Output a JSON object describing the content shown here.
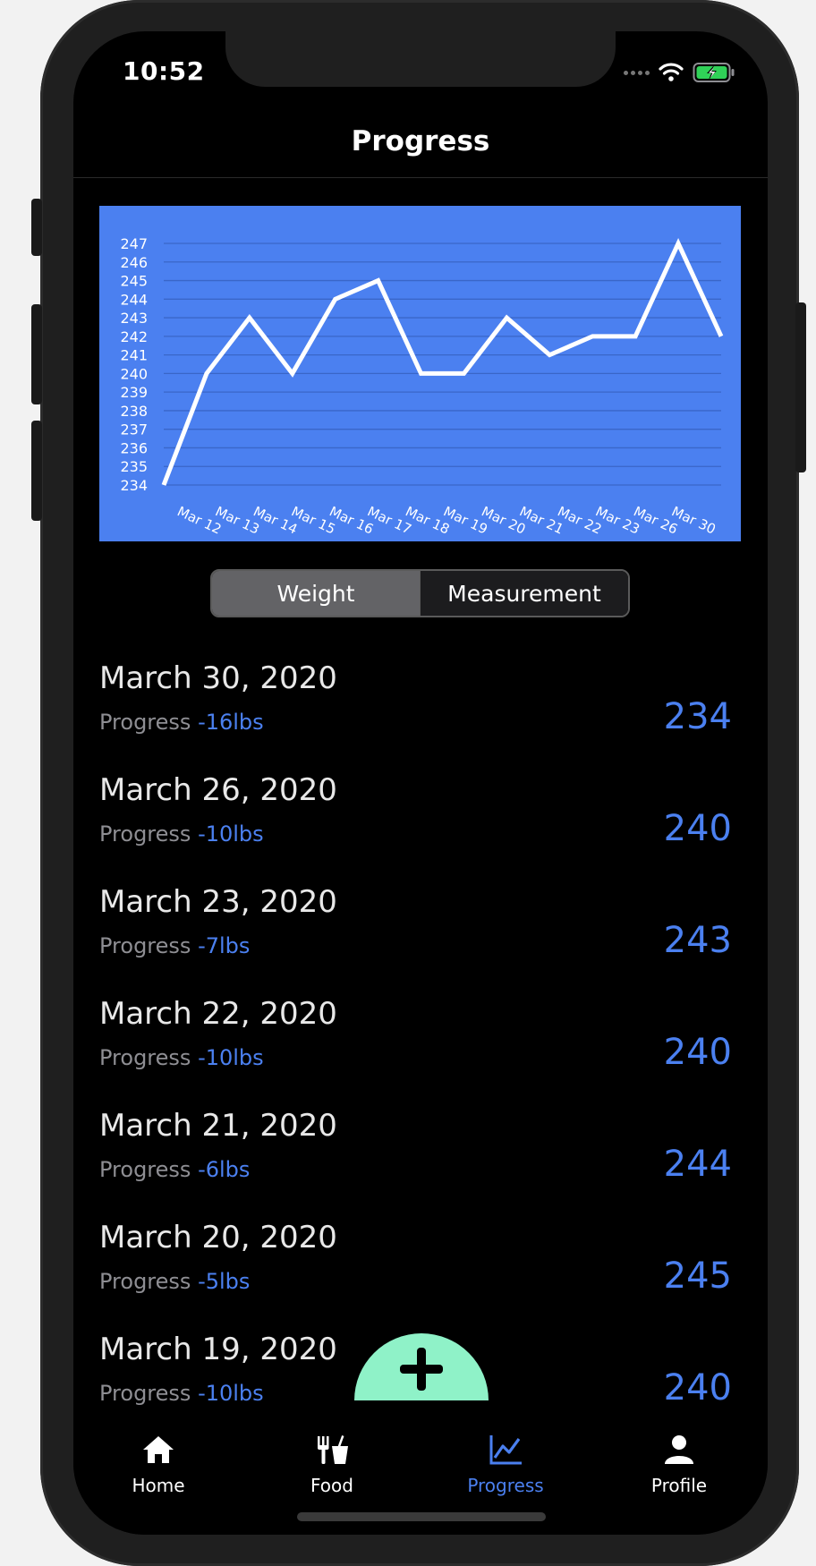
{
  "status_bar": {
    "time": "10:52"
  },
  "nav": {
    "title": "Progress"
  },
  "chart_data": {
    "type": "line",
    "x": [
      "Mar 12",
      "Mar 13",
      "Mar 14",
      "Mar 15",
      "Mar 16",
      "Mar 17",
      "Mar 18",
      "Mar 19",
      "Mar 20",
      "Mar 21",
      "Mar 22",
      "Mar 23",
      "Mar 26",
      "Mar 30"
    ],
    "values": [
      234,
      240,
      243,
      240,
      244,
      245,
      240,
      240,
      243,
      241,
      242,
      242,
      247,
      242
    ],
    "y_ticks": [
      247,
      246,
      245,
      244,
      243,
      242,
      241,
      240,
      239,
      238,
      237,
      236,
      235,
      234
    ],
    "ylim": [
      234,
      247
    ],
    "grid": true,
    "colors": {
      "background": "#4b80f0",
      "line": "#ffffff",
      "grid": "#3a66c8"
    }
  },
  "segmented": {
    "options": [
      "Weight",
      "Measurement"
    ],
    "selected": "Weight"
  },
  "entries": [
    {
      "date": "March 30, 2020",
      "label": "Progress",
      "change": "-16lbs",
      "weight": "234"
    },
    {
      "date": "March 26, 2020",
      "label": "Progress",
      "change": "-10lbs",
      "weight": "240"
    },
    {
      "date": "March 23, 2020",
      "label": "Progress",
      "change": "-7lbs",
      "weight": "243"
    },
    {
      "date": "March 22, 2020",
      "label": "Progress",
      "change": "-10lbs",
      "weight": "240"
    },
    {
      "date": "March 21, 2020",
      "label": "Progress",
      "change": "-6lbs",
      "weight": "244"
    },
    {
      "date": "March 20, 2020",
      "label": "Progress",
      "change": "-5lbs",
      "weight": "245"
    },
    {
      "date": "March 19, 2020",
      "label": "Progress",
      "change": "-10lbs",
      "weight": "240"
    }
  ],
  "fab": {
    "icon": "plus-icon",
    "color": "#8ff2c8"
  },
  "tabs": [
    {
      "label": "Home",
      "icon": "home-icon"
    },
    {
      "label": "Food",
      "icon": "food-icon"
    },
    {
      "label": "Progress",
      "icon": "chart-icon",
      "active": true
    },
    {
      "label": "Profile",
      "icon": "person-icon"
    }
  ],
  "colors": {
    "accent": "#4b80f0",
    "background": "#000000"
  }
}
